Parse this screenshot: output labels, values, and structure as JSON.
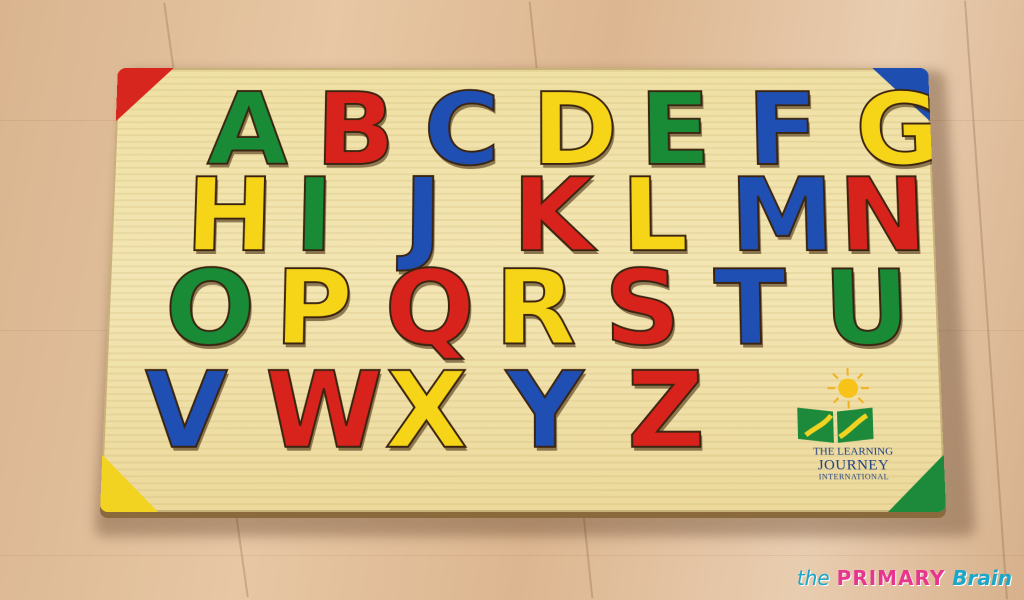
{
  "board": {
    "rows": [
      [
        {
          "char": "A",
          "color": "green"
        },
        {
          "char": "B",
          "color": "red"
        },
        {
          "char": "C",
          "color": "blue"
        },
        {
          "char": "D",
          "color": "yellow"
        },
        {
          "char": "E",
          "color": "green"
        },
        {
          "char": "F",
          "color": "blue"
        },
        {
          "char": "G",
          "color": "yellow"
        }
      ],
      [
        {
          "char": "H",
          "color": "yellow"
        },
        {
          "char": "I",
          "color": "green"
        },
        {
          "char": "J",
          "color": "blue"
        },
        {
          "char": "K",
          "color": "red"
        },
        {
          "char": "L",
          "color": "yellow"
        },
        {
          "char": "M",
          "color": "blue"
        },
        {
          "char": "N",
          "color": "red"
        }
      ],
      [
        {
          "char": "O",
          "color": "green"
        },
        {
          "char": "P",
          "color": "yellow"
        },
        {
          "char": "Q",
          "color": "red"
        },
        {
          "char": "R",
          "color": "yellow"
        },
        {
          "char": "S",
          "color": "red"
        },
        {
          "char": "T",
          "color": "blue"
        },
        {
          "char": "U",
          "color": "green"
        }
      ],
      [
        {
          "char": "V",
          "color": "blue"
        },
        {
          "char": "W",
          "color": "red"
        },
        {
          "char": "X",
          "color": "yellow"
        },
        {
          "char": "Y",
          "color": "blue"
        },
        {
          "char": "Z",
          "color": "red"
        }
      ]
    ],
    "colors": {
      "red": "#d8231c",
      "blue": "#1f4fb2",
      "yellow": "#f6d418",
      "green": "#198a36"
    }
  },
  "logo": {
    "line1": "THE LEARNING",
    "line2": "JOURNEY",
    "line3": "INTERNATIONAL"
  },
  "watermark": {
    "part1": "the",
    "part2": "PRIMARY",
    "part3": "Brain"
  }
}
